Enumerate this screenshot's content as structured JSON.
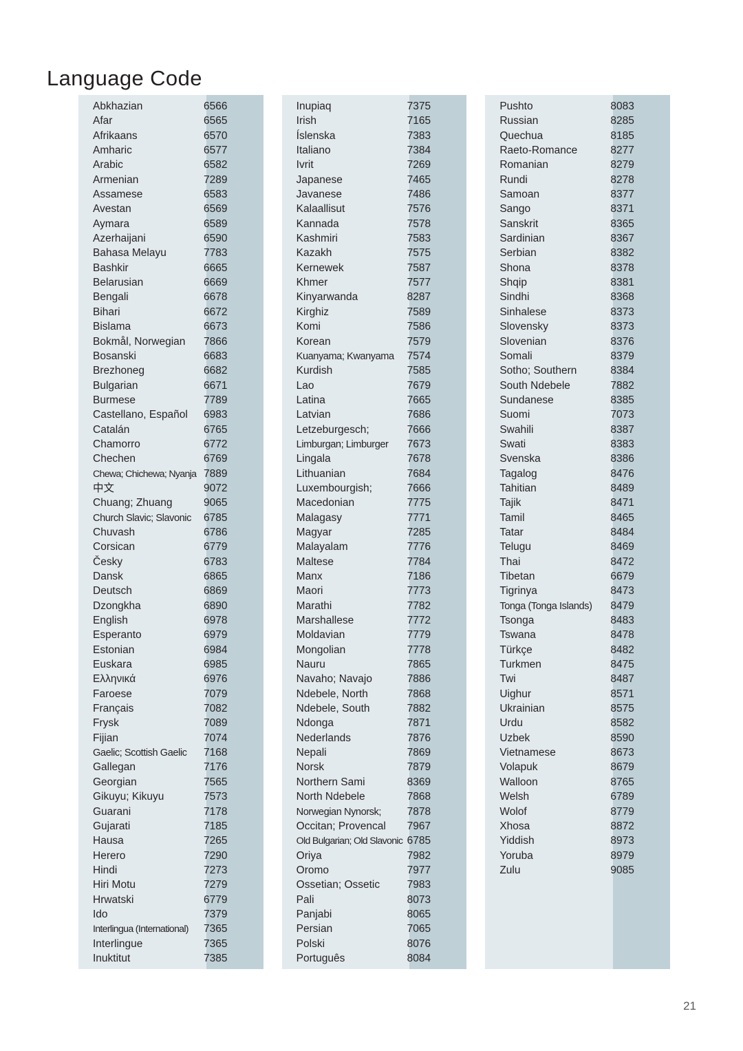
{
  "document": {
    "title": "Language Code",
    "page_number": "21"
  },
  "colors": {
    "page_background": "#ffffff",
    "block_background": "#e3eaee",
    "code_strip_background": "#bfd0d7",
    "text": "#231f20",
    "page_number_text": "#58595b"
  },
  "columns": [
    {
      "id": "column-1",
      "entries": [
        {
          "language": "Abkhazian",
          "code": "6566"
        },
        {
          "language": "Afar",
          "code": "6565"
        },
        {
          "language": "Afrikaans",
          "code": "6570"
        },
        {
          "language": "Amharic",
          "code": "6577"
        },
        {
          "language": "Arabic",
          "code": "6582"
        },
        {
          "language": "Armenian",
          "code": "7289"
        },
        {
          "language": "Assamese",
          "code": "6583"
        },
        {
          "language": "Avestan",
          "code": "6569"
        },
        {
          "language": "Aymara",
          "code": "6589"
        },
        {
          "language": "Azerhaijani",
          "code": "6590"
        },
        {
          "language": "Bahasa Melayu",
          "code": "7783"
        },
        {
          "language": "Bashkir",
          "code": "6665"
        },
        {
          "language": "Belarusian",
          "code": "6669"
        },
        {
          "language": "Bengali",
          "code": "6678"
        },
        {
          "language": "Bihari",
          "code": "6672"
        },
        {
          "language": "Bislama",
          "code": "6673"
        },
        {
          "language": "Bokmål, Norwegian",
          "code": "7866"
        },
        {
          "language": "Bosanski",
          "code": "6683"
        },
        {
          "language": "Brezhoneg",
          "code": "6682"
        },
        {
          "language": "Bulgarian",
          "code": "6671"
        },
        {
          "language": "Burmese",
          "code": "7789"
        },
        {
          "language": "Castellano, Español",
          "code": "6983"
        },
        {
          "language": "Catalán",
          "code": "6765"
        },
        {
          "language": "Chamorro",
          "code": "6772"
        },
        {
          "language": "Chechen",
          "code": "6769"
        },
        {
          "language": "Chewa; Chichewa; Nyanja",
          "code": "7889",
          "fit": "squeeze-hard"
        },
        {
          "language": "中文",
          "code": "9072"
        },
        {
          "language": "Chuang; Zhuang",
          "code": "9065"
        },
        {
          "language": "Church Slavic; Slavonic",
          "code": "6785",
          "fit": "squeeze"
        },
        {
          "language": "Chuvash",
          "code": "6786"
        },
        {
          "language": "Corsican",
          "code": "6779"
        },
        {
          "language": "Česky",
          "code": "6783"
        },
        {
          "language": "Dansk",
          "code": "6865"
        },
        {
          "language": "Deutsch",
          "code": "6869"
        },
        {
          "language": "Dzongkha",
          "code": "6890"
        },
        {
          "language": "English",
          "code": "6978"
        },
        {
          "language": "Esperanto",
          "code": "6979"
        },
        {
          "language": "Estonian",
          "code": "6984"
        },
        {
          "language": "Euskara",
          "code": "6985"
        },
        {
          "language": "Ελληνικά",
          "code": "6976"
        },
        {
          "language": "Faroese",
          "code": "7079"
        },
        {
          "language": "Français",
          "code": "7082"
        },
        {
          "language": "Frysk",
          "code": "7089"
        },
        {
          "language": "Fijian",
          "code": "7074"
        },
        {
          "language": "Gaelic; Scottish Gaelic",
          "code": "7168",
          "fit": "squeeze"
        },
        {
          "language": "Gallegan",
          "code": "7176"
        },
        {
          "language": "Georgian",
          "code": "7565"
        },
        {
          "language": "Gikuyu; Kikuyu",
          "code": "7573"
        },
        {
          "language": "Guarani",
          "code": "7178"
        },
        {
          "language": "Gujarati",
          "code": "7185"
        },
        {
          "language": "Hausa",
          "code": "7265"
        },
        {
          "language": "Herero",
          "code": "7290"
        },
        {
          "language": "Hindi",
          "code": "7273"
        },
        {
          "language": "Hiri Motu",
          "code": "7279"
        },
        {
          "language": "Hrwatski",
          "code": "6779"
        },
        {
          "language": "Ido",
          "code": "7379"
        },
        {
          "language": "Interlingua (International)",
          "code": "7365",
          "fit": "squeeze-hard"
        },
        {
          "language": "Interlingue",
          "code": "7365"
        },
        {
          "language": "Inuktitut",
          "code": "7385"
        }
      ]
    },
    {
      "id": "column-2",
      "entries": [
        {
          "language": "Inupiaq",
          "code": "7375"
        },
        {
          "language": "Irish",
          "code": "7165"
        },
        {
          "language": "Íslenska",
          "code": "7383"
        },
        {
          "language": "Italiano",
          "code": "7384"
        },
        {
          "language": "Ivrit",
          "code": "7269"
        },
        {
          "language": "Japanese",
          "code": "7465"
        },
        {
          "language": "Javanese",
          "code": "7486"
        },
        {
          "language": "Kalaallisut",
          "code": "7576"
        },
        {
          "language": "Kannada",
          "code": "7578"
        },
        {
          "language": "Kashmiri",
          "code": "7583"
        },
        {
          "language": "Kazakh",
          "code": "7575"
        },
        {
          "language": "Kernewek",
          "code": "7587"
        },
        {
          "language": "Khmer",
          "code": "7577"
        },
        {
          "language": "Kinyarwanda",
          "code": "8287"
        },
        {
          "language": "Kirghiz",
          "code": "7589"
        },
        {
          "language": "Komi",
          "code": "7586"
        },
        {
          "language": "Korean",
          "code": "7579"
        },
        {
          "language": "Kuanyama; Kwanyama",
          "code": "7574",
          "fit": "squeeze"
        },
        {
          "language": "Kurdish",
          "code": "7585"
        },
        {
          "language": "Lao",
          "code": "7679"
        },
        {
          "language": "Latina",
          "code": "7665"
        },
        {
          "language": "Latvian",
          "code": "7686"
        },
        {
          "language": "Letzeburgesch;",
          "code": "7666"
        },
        {
          "language": "Limburgan; Limburger",
          "code": "7673",
          "fit": "squeeze"
        },
        {
          "language": "Lingala",
          "code": "7678"
        },
        {
          "language": "Lithuanian",
          "code": "7684"
        },
        {
          "language": "Luxembourgish;",
          "code": "7666"
        },
        {
          "language": "Macedonian",
          "code": "7775"
        },
        {
          "language": "Malagasy",
          "code": "7771"
        },
        {
          "language": "Magyar",
          "code": "7285"
        },
        {
          "language": "Malayalam",
          "code": "7776"
        },
        {
          "language": "Maltese",
          "code": "7784"
        },
        {
          "language": "Manx",
          "code": "7186"
        },
        {
          "language": "Maori",
          "code": "7773"
        },
        {
          "language": "Marathi",
          "code": "7782"
        },
        {
          "language": "Marshallese",
          "code": "7772"
        },
        {
          "language": "Moldavian",
          "code": "7779"
        },
        {
          "language": "Mongolian",
          "code": "7778"
        },
        {
          "language": "Nauru",
          "code": "7865"
        },
        {
          "language": "Navaho; Navajo",
          "code": "7886"
        },
        {
          "language": "Ndebele, North",
          "code": "7868"
        },
        {
          "language": "Ndebele, South",
          "code": "7882"
        },
        {
          "language": "Ndonga",
          "code": "7871"
        },
        {
          "language": "Nederlands",
          "code": "7876"
        },
        {
          "language": "Nepali",
          "code": "7869"
        },
        {
          "language": "Norsk",
          "code": "7879"
        },
        {
          "language": "Northern Sami",
          "code": "8369"
        },
        {
          "language": "North Ndebele",
          "code": "7868"
        },
        {
          "language": "Norwegian Nynorsk;",
          "code": "7878",
          "fit": "squeeze"
        },
        {
          "language": "Occitan; Provencal",
          "code": "7967"
        },
        {
          "language": "Old Bulgarian; Old Slavonic",
          "code": "6785",
          "fit": "squeeze-hard"
        },
        {
          "language": "Oriya",
          "code": "7982"
        },
        {
          "language": "Oromo",
          "code": "7977"
        },
        {
          "language": "Ossetian; Ossetic",
          "code": "7983"
        },
        {
          "language": "Pali",
          "code": "8073"
        },
        {
          "language": "Panjabi",
          "code": "8065"
        },
        {
          "language": "Persian",
          "code": "7065"
        },
        {
          "language": "Polski",
          "code": "8076"
        },
        {
          "language": "Português",
          "code": "8084"
        }
      ]
    },
    {
      "id": "column-3",
      "entries": [
        {
          "language": "Pushto",
          "code": "8083"
        },
        {
          "language": "Russian",
          "code": "8285"
        },
        {
          "language": "Quechua",
          "code": "8185"
        },
        {
          "language": "Raeto-Romance",
          "code": "8277"
        },
        {
          "language": "Romanian",
          "code": "8279"
        },
        {
          "language": "Rundi",
          "code": "8278"
        },
        {
          "language": "Samoan",
          "code": "8377"
        },
        {
          "language": "Sango",
          "code": "8371"
        },
        {
          "language": "Sanskrit",
          "code": "8365"
        },
        {
          "language": "Sardinian",
          "code": "8367"
        },
        {
          "language": "Serbian",
          "code": "8382"
        },
        {
          "language": "Shona",
          "code": "8378"
        },
        {
          "language": "Shqip",
          "code": "8381"
        },
        {
          "language": "Sindhi",
          "code": "8368"
        },
        {
          "language": "Sinhalese",
          "code": "8373"
        },
        {
          "language": "Slovensky",
          "code": "8373"
        },
        {
          "language": "Slovenian",
          "code": "8376"
        },
        {
          "language": "Somali",
          "code": "8379"
        },
        {
          "language": "Sotho; Southern",
          "code": "8384"
        },
        {
          "language": "South Ndebele",
          "code": "7882"
        },
        {
          "language": "Sundanese",
          "code": "8385"
        },
        {
          "language": "Suomi",
          "code": "7073"
        },
        {
          "language": "Swahili",
          "code": "8387"
        },
        {
          "language": "Swati",
          "code": "8383"
        },
        {
          "language": "Svenska",
          "code": "8386"
        },
        {
          "language": "Tagalog",
          "code": "8476"
        },
        {
          "language": "Tahitian",
          "code": "8489"
        },
        {
          "language": "Tajik",
          "code": "8471"
        },
        {
          "language": "Tamil",
          "code": "8465"
        },
        {
          "language": "Tatar",
          "code": "8484"
        },
        {
          "language": "Telugu",
          "code": "8469"
        },
        {
          "language": "Thai",
          "code": "8472"
        },
        {
          "language": "Tibetan",
          "code": "6679"
        },
        {
          "language": "Tigrinya",
          "code": "8473"
        },
        {
          "language": "Tonga (Tonga Islands)",
          "code": "8479",
          "fit": "squeeze"
        },
        {
          "language": "Tsonga",
          "code": "8483"
        },
        {
          "language": "Tswana",
          "code": "8478"
        },
        {
          "language": "Türkçe",
          "code": "8482"
        },
        {
          "language": "Turkmen",
          "code": "8475"
        },
        {
          "language": "Twi",
          "code": "8487"
        },
        {
          "language": "Uighur",
          "code": "8571"
        },
        {
          "language": "Ukrainian",
          "code": "8575"
        },
        {
          "language": "Urdu",
          "code": "8582"
        },
        {
          "language": "Uzbek",
          "code": "8590"
        },
        {
          "language": "Vietnamese",
          "code": "8673"
        },
        {
          "language": "Volapuk",
          "code": "8679"
        },
        {
          "language": "Walloon",
          "code": "8765"
        },
        {
          "language": "Welsh",
          "code": "6789"
        },
        {
          "language": "Wolof",
          "code": "8779"
        },
        {
          "language": "Xhosa",
          "code": "8872"
        },
        {
          "language": "Yiddish",
          "code": "8973"
        },
        {
          "language": "Yoruba",
          "code": "8979"
        },
        {
          "language": "Zulu",
          "code": "9085"
        }
      ]
    }
  ]
}
